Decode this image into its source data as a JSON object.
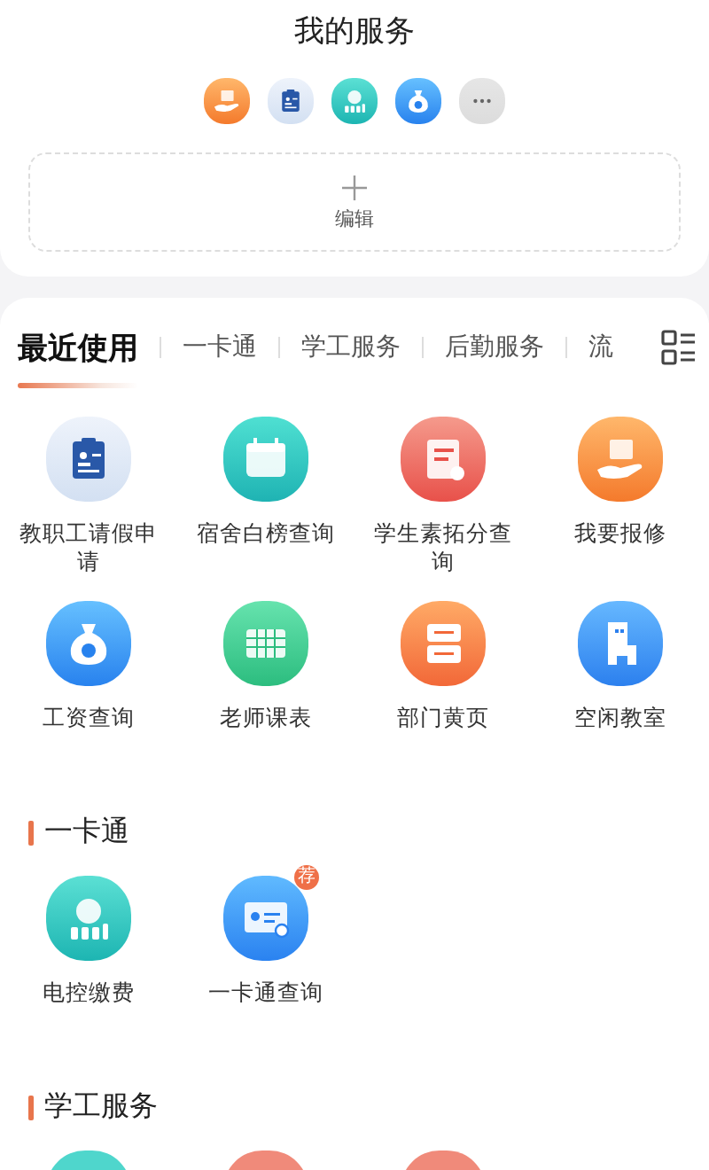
{
  "header": {
    "title": "我的服务"
  },
  "my_services": [
    {
      "kind": "repair"
    },
    {
      "kind": "leave"
    },
    {
      "kind": "power"
    },
    {
      "kind": "salary"
    },
    {
      "kind": "more"
    }
  ],
  "edit_button": {
    "label": "编辑"
  },
  "tabs": [
    {
      "label": "最近使用",
      "selected": true
    },
    {
      "label": "一卡通",
      "selected": false
    },
    {
      "label": "学工服务",
      "selected": false
    },
    {
      "label": "后勤服务",
      "selected": false
    },
    {
      "label": "流",
      "selected": false
    }
  ],
  "recent": [
    {
      "label": "教职工请假申请",
      "kind": "leave"
    },
    {
      "label": "宿舍白榜查询",
      "kind": "dorm"
    },
    {
      "label": "学生素拓分查询",
      "kind": "score"
    },
    {
      "label": "我要报修",
      "kind": "repair"
    },
    {
      "label": "工资查询",
      "kind": "salary"
    },
    {
      "label": "老师课表",
      "kind": "timetable"
    },
    {
      "label": "部门黄页",
      "kind": "directory"
    },
    {
      "label": "空闲教室",
      "kind": "classroom"
    }
  ],
  "sections": [
    {
      "title": "一卡通",
      "items": [
        {
          "label": "电控缴费",
          "kind": "power"
        },
        {
          "label": "一卡通查询",
          "kind": "card",
          "badge": "荐"
        }
      ]
    },
    {
      "title": "学工服务",
      "items": [
        {
          "kind": "plain",
          "color": "#4fd6cc"
        },
        {
          "kind": "plain",
          "color": "#f08a7a"
        },
        {
          "kind": "plain",
          "color": "#f08a7a"
        }
      ]
    }
  ]
}
